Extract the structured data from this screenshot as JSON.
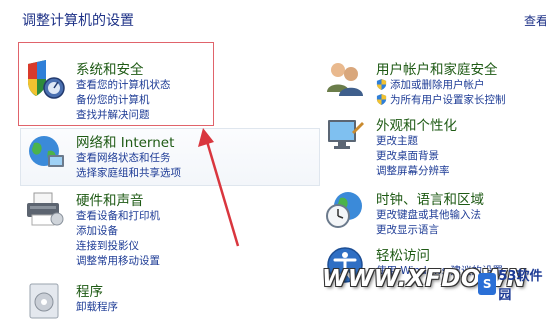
{
  "header": {
    "title": "调整计算机的设置",
    "view_by": "查看"
  },
  "categories": [
    {
      "heading": "系统和安全",
      "links": [
        "查看您的计算机状态",
        "备份您的计算机",
        "查找并解决问题"
      ]
    },
    {
      "heading": "网络和 Internet",
      "links": [
        "查看网络状态和任务",
        "选择家庭组和共享选项"
      ]
    },
    {
      "heading": "硬件和声音",
      "links": [
        "查看设备和打印机",
        "添加设备",
        "连接到投影仪",
        "调整常用移动设置"
      ]
    },
    {
      "heading": "程序",
      "links": [
        "卸载程序"
      ]
    },
    {
      "heading": "用户帐户和家庭安全",
      "links": [
        "添加或删除用户帐户",
        "为所有用户设置家长控制"
      ]
    },
    {
      "heading": "外观和个性化",
      "links": [
        "更改主题",
        "更改桌面背景",
        "调整屏幕分辨率"
      ]
    },
    {
      "heading": "时钟、语言和区域",
      "links": [
        "更改键盘或其他输入法",
        "更改显示语言"
      ]
    },
    {
      "heading": "轻松访问",
      "links": [
        "使用 Windows 建议的设置"
      ]
    }
  ],
  "watermark": {
    "text": "WWW.XFDOWN",
    "logo_mark": "S",
    "logo_text": "53软件园"
  },
  "colors": {
    "link": "#1e3c96",
    "heading": "#1e5a14",
    "highlight_box": "#e0636b",
    "arrow": "#d9363e"
  }
}
